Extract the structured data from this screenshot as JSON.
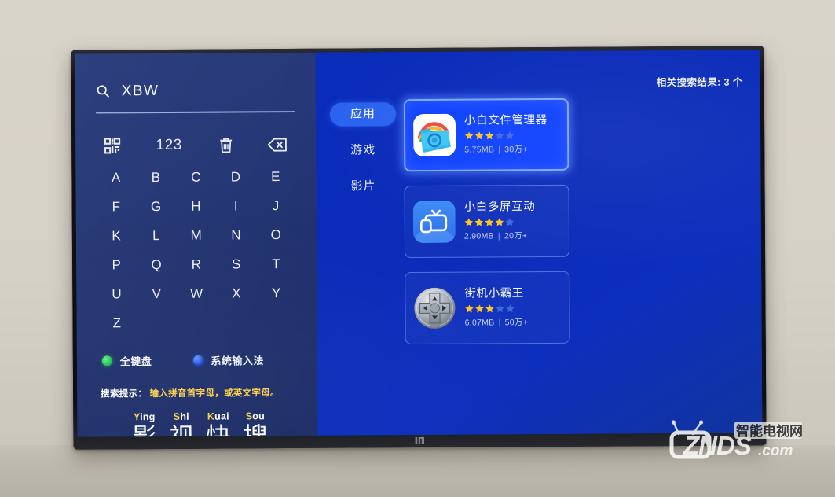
{
  "device": {
    "brand_logo": "mi-logo",
    "screen_bg": "#0a2cbb",
    "panel_bg": "#27397a"
  },
  "search": {
    "icon": "search-icon",
    "query": "XBW",
    "placeholder": ""
  },
  "keyboard": {
    "function_keys": [
      {
        "name": "qr-keyboard-icon",
        "label": ""
      },
      {
        "name": "numeric-key",
        "label": "123"
      },
      {
        "name": "trash-icon",
        "label": ""
      },
      {
        "name": "backspace-icon",
        "label": ""
      }
    ],
    "letters": [
      "A",
      "B",
      "C",
      "D",
      "E",
      "F",
      "G",
      "H",
      "I",
      "J",
      "K",
      "L",
      "M",
      "N",
      "O",
      "P",
      "Q",
      "R",
      "S",
      "T",
      "U",
      "V",
      "W",
      "X",
      "Y",
      "Z"
    ]
  },
  "legend": [
    {
      "dot": "green",
      "label": "全键盘"
    },
    {
      "dot": "blue",
      "label": "系统输入法"
    }
  ],
  "hint": {
    "label": "搜索提示：",
    "value": "输入拼音首字母，或英文字母。"
  },
  "pinyin_examples": [
    {
      "initial": "Y",
      "rest": "ing",
      "han": "影"
    },
    {
      "initial": "S",
      "rest": "hi",
      "han": "视"
    },
    {
      "initial": "K",
      "rest": "uai",
      "han": "快"
    },
    {
      "initial": "S",
      "rest": "ou",
      "han": "搜"
    }
  ],
  "results": {
    "count_label": "相关搜索结果: 3 个",
    "tabs": [
      {
        "label": "应用",
        "active": true
      },
      {
        "label": "游戏",
        "active": false
      },
      {
        "label": "影片",
        "active": false
      }
    ],
    "apps": [
      {
        "name": "小白文件管理器",
        "icon": "file-manager-icon",
        "stars_filled": 3,
        "stars_total": 5,
        "size": "5.75MB",
        "downloads": "30万+",
        "selected": true
      },
      {
        "name": "小白多屏互动",
        "icon": "multiscreen-tv-icon",
        "stars_filled": 4,
        "stars_total": 5,
        "size": "2.90MB",
        "downloads": "20万+",
        "selected": false
      },
      {
        "name": "街机小霸王",
        "icon": "gamepad-icon",
        "stars_filled": 3,
        "stars_total": 5,
        "size": "6.07MB",
        "downloads": "50万+",
        "selected": false
      }
    ]
  },
  "watermark": {
    "cn_text": "智能电视网",
    "brand": "ZNDS",
    "suffix": ".com"
  },
  "colors": {
    "accent_blue": "#2a63ef",
    "star_gold": "#ffc51e",
    "star_dim": "#3f6ad8",
    "hint_yellow": "#ffd24a"
  }
}
